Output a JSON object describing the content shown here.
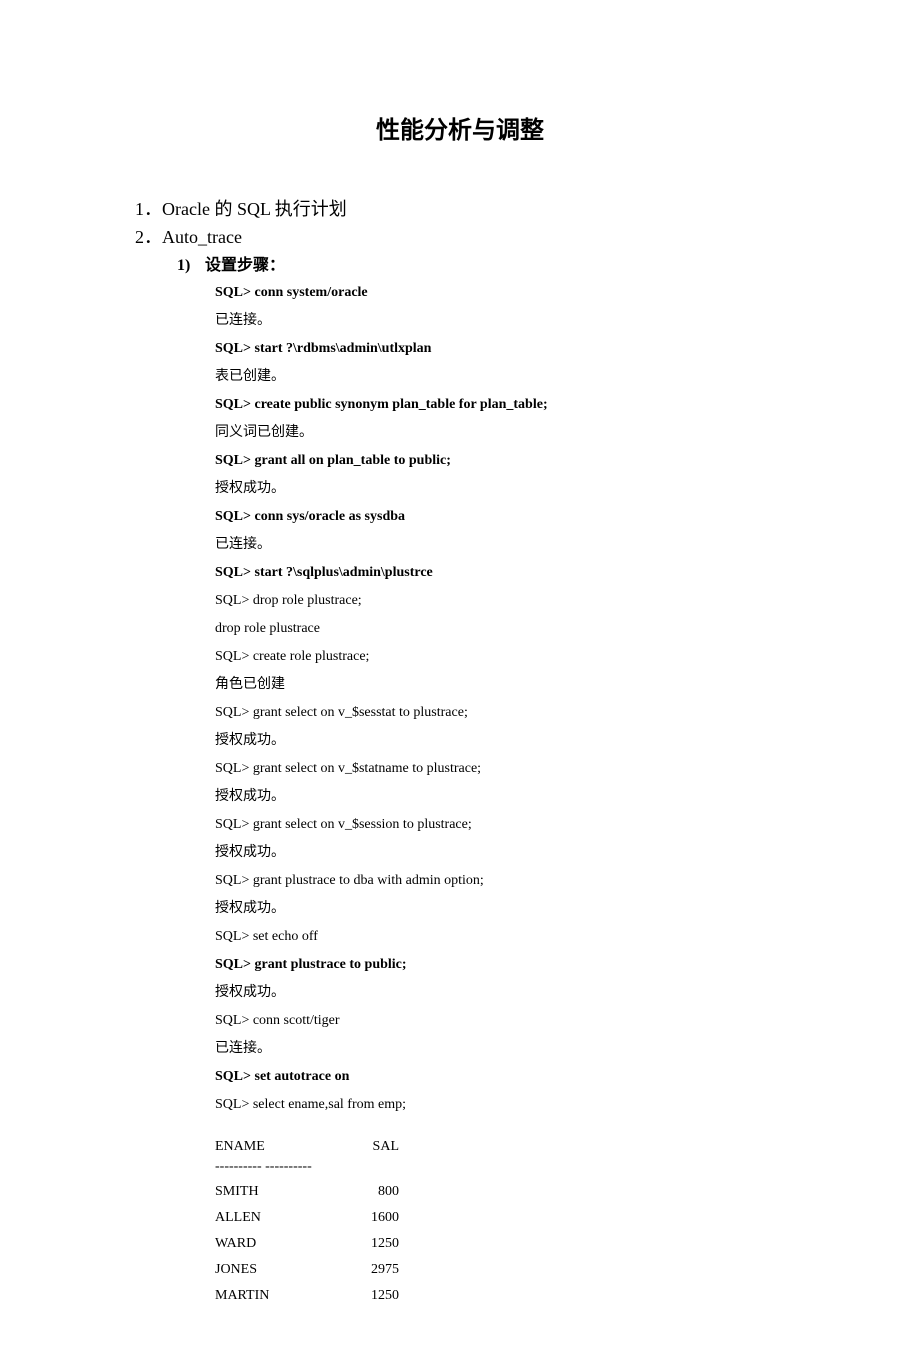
{
  "title": "性能分析与调整",
  "items": {
    "item1": "1．Oracle 的 SQL 执行计划",
    "item2": "2．Auto_trace",
    "sub1_num": "1)",
    "sub1_label": "设置步骤："
  },
  "lines": [
    {
      "text": "SQL> conn system/oracle",
      "bold": true
    },
    {
      "text": "已连接。",
      "bold": false
    },
    {
      "text": "SQL> start ?\\rdbms\\admin\\utlxplan",
      "bold": true
    },
    {
      "text": "表已创建。",
      "bold": false
    },
    {
      "text": "SQL> create public synonym plan_table for plan_table;",
      "bold": true
    },
    {
      "text": "同义词已创建。",
      "bold": false
    },
    {
      "text": "SQL> grant all on plan_table to public;",
      "bold": true
    },
    {
      "text": "授权成功。",
      "bold": false
    },
    {
      "text": "SQL> conn sys/oracle as sysdba",
      "bold": true
    },
    {
      "text": "已连接。",
      "bold": false
    },
    {
      "text": "SQL> start ?\\sqlplus\\admin\\plustrce",
      "bold": true
    },
    {
      "text": "SQL> drop role plustrace;",
      "bold": false
    },
    {
      "text": "drop role plustrace",
      "bold": false
    },
    {
      "text": "SQL> create role plustrace;",
      "bold": false
    },
    {
      "text": "角色已创建",
      "bold": false
    },
    {
      "text": "SQL> grant select on v_$sesstat to plustrace;",
      "bold": false
    },
    {
      "text": "授权成功。",
      "bold": false
    },
    {
      "text": "SQL> grant select on v_$statname to plustrace;",
      "bold": false
    },
    {
      "text": "授权成功。",
      "bold": false
    },
    {
      "text": "SQL> grant select on v_$session to plustrace;",
      "bold": false
    },
    {
      "text": "授权成功。",
      "bold": false
    },
    {
      "text": "SQL> grant plustrace to dba with admin option;",
      "bold": false
    },
    {
      "text": "授权成功。",
      "bold": false
    },
    {
      "text": "SQL> set echo off",
      "bold": false
    },
    {
      "text": "SQL> grant plustrace to public;",
      "bold": true
    },
    {
      "text": "授权成功。",
      "bold": false
    },
    {
      "text": "SQL> conn scott/tiger",
      "bold": false
    },
    {
      "text": "已连接。",
      "bold": false
    },
    {
      "text": "SQL> set autotrace on",
      "bold": true
    },
    {
      "text": "SQL> select ename,sal from emp;",
      "bold": false
    }
  ],
  "table": {
    "header_ename": "ENAME",
    "header_sal": "SAL",
    "separator": "---------- ----------",
    "rows": [
      {
        "ename": "SMITH",
        "sal": "800"
      },
      {
        "ename": "ALLEN",
        "sal": "1600"
      },
      {
        "ename": "WARD",
        "sal": "1250"
      },
      {
        "ename": "JONES",
        "sal": "2975"
      },
      {
        "ename": "MARTIN",
        "sal": "1250"
      }
    ]
  }
}
